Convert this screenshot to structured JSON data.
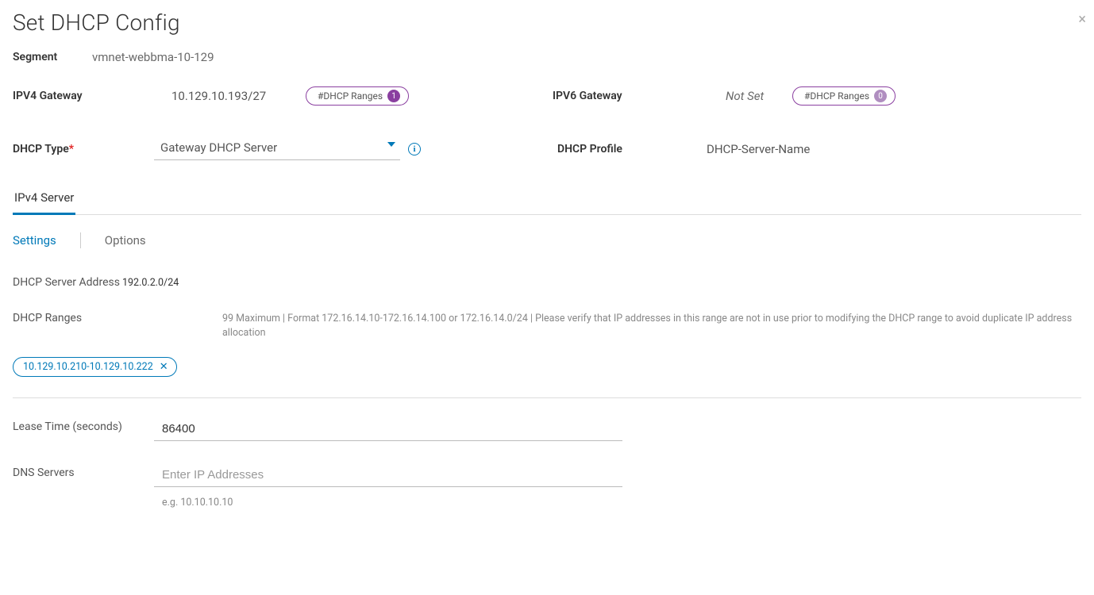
{
  "title": "Set DHCP Config",
  "close_label": "×",
  "segment": {
    "label": "Segment",
    "value": "vmnet-webbma-10-129"
  },
  "ipv4_gateway": {
    "label": "IPV4 Gateway",
    "value": "10.129.10.193/27",
    "badge_label": "#DHCP Ranges",
    "badge_count": "1"
  },
  "ipv6_gateway": {
    "label": "IPV6 Gateway",
    "value": "Not Set",
    "badge_label": "#DHCP Ranges",
    "badge_count": "0"
  },
  "dhcp_type": {
    "label": "DHCP Type",
    "required": "*",
    "value": "Gateway DHCP Server"
  },
  "dhcp_profile": {
    "label": "DHCP Profile",
    "value": "DHCP-Server-Name"
  },
  "tabs_primary": {
    "ipv4": "IPv4 Server"
  },
  "tabs_secondary": {
    "settings": "Settings",
    "options": "Options"
  },
  "dhcp_server_address": {
    "label": "DHCP Server Address",
    "value": "192.0.2.0/24"
  },
  "dhcp_ranges": {
    "label": "DHCP Ranges",
    "hint": "99 Maximum | Format 172.16.14.10-172.16.14.100 or 172.16.14.0/24 | Please verify that IP addresses in this range are not in use prior to modifying the DHCP range to avoid duplicate IP address allocation",
    "chips": [
      "10.129.10.210-10.129.10.222"
    ]
  },
  "lease_time": {
    "label": "Lease Time (seconds)",
    "value": "86400"
  },
  "dns_servers": {
    "label": "DNS Servers",
    "placeholder": "Enter IP Addresses",
    "hint": "e.g. 10.10.10.10"
  }
}
